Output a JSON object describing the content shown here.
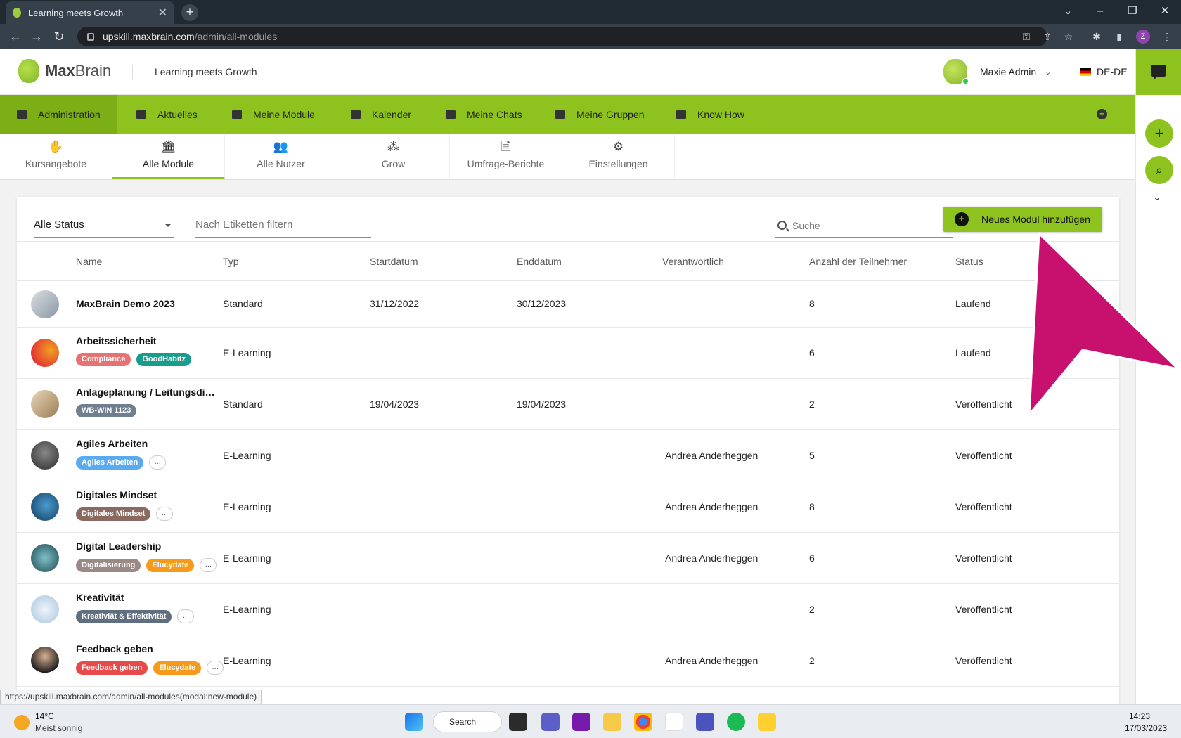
{
  "browser": {
    "tab_title": "Learning meets Growth",
    "url_host": "upskill.maxbrain.com",
    "url_path": "/admin/all-modules",
    "profile_initial": "Z",
    "status_url": "https://upskill.maxbrain.com/admin/all-modules(modal:new-module)"
  },
  "header": {
    "logo_bold": "Max",
    "logo_light": "Brain",
    "tagline": "Learning meets Growth",
    "user_name": "Maxie Admin",
    "language": "DE-DE"
  },
  "nav": {
    "items": [
      {
        "label": "Administration",
        "icon": "dashboard-icon"
      },
      {
        "label": "Aktuelles",
        "icon": "news-icon"
      },
      {
        "label": "Meine Module",
        "icon": "graduation-cap-icon"
      },
      {
        "label": "Kalender",
        "icon": "calendar-icon"
      },
      {
        "label": "Meine Chats",
        "icon": "chat-icon"
      },
      {
        "label": "Meine Gruppen",
        "icon": "group-icon"
      },
      {
        "label": "Know How",
        "icon": "book-icon"
      }
    ]
  },
  "subtabs": [
    {
      "label": "Kursangebote",
      "icon": "hand-book-icon"
    },
    {
      "label": "Alle Module",
      "icon": "institution-icon"
    },
    {
      "label": "Alle Nutzer",
      "icon": "users-icon"
    },
    {
      "label": "Grow",
      "icon": "people-group-icon"
    },
    {
      "label": "Umfrage-Berichte",
      "icon": "report-file-icon"
    },
    {
      "label": "Einstellungen",
      "icon": "gears-icon"
    }
  ],
  "filters": {
    "status_value": "Alle Status",
    "tags_placeholder": "Nach Etiketten filtern",
    "search_placeholder": "Suche",
    "add_button": "Neues Modul hinzufügen"
  },
  "table": {
    "columns": [
      "Name",
      "Typ",
      "Startdatum",
      "Enddatum",
      "Verantwortlich",
      "Anzahl der Teilnehmer",
      "Status"
    ],
    "rows": [
      {
        "name": "MaxBrain Demo 2023",
        "type": "Standard",
        "start": "31/12/2022",
        "end": "30/12/2023",
        "owner": "",
        "count": "8",
        "status": "Laufend",
        "tags": [],
        "more": false
      },
      {
        "name": "Arbeitssicherheit",
        "type": "E-Learning",
        "start": "",
        "end": "",
        "owner": "",
        "count": "6",
        "status": "Laufend",
        "tags": [
          {
            "label": "Compliance",
            "color": "#e57373"
          },
          {
            "label": "GoodHabitz",
            "color": "#1a9c8c"
          }
        ],
        "more": false
      },
      {
        "name": "Anlageplanung / Leitungsdimensionierung",
        "type": "Standard",
        "start": "19/04/2023",
        "end": "19/04/2023",
        "owner": "",
        "count": "2",
        "status": "Veröffentlicht",
        "tags": [
          {
            "label": "WB-WIN 1123",
            "color": "#6f7f8f"
          }
        ],
        "more": false
      },
      {
        "name": "Agiles Arbeiten",
        "type": "E-Learning",
        "start": "",
        "end": "",
        "owner": "Andrea Anderheggen",
        "count": "5",
        "status": "Veröffentlicht",
        "tags": [
          {
            "label": "Agiles Arbeiten",
            "color": "#5aaaf0"
          }
        ],
        "more": true
      },
      {
        "name": "Digitales Mindset",
        "type": "E-Learning",
        "start": "",
        "end": "",
        "owner": "Andrea Anderheggen",
        "count": "8",
        "status": "Veröffentlicht",
        "tags": [
          {
            "label": "Digitales Mindset",
            "color": "#8a6a60"
          }
        ],
        "more": true
      },
      {
        "name": "Digital Leadership",
        "type": "E-Learning",
        "start": "",
        "end": "",
        "owner": "Andrea Anderheggen",
        "count": "6",
        "status": "Veröffentlicht",
        "tags": [
          {
            "label": "Digitalisierung",
            "color": "#9a8a86"
          },
          {
            "label": "Elucydate",
            "color": "#f59a1a"
          }
        ],
        "more": true
      },
      {
        "name": "Kreativität",
        "type": "E-Learning",
        "start": "",
        "end": "",
        "owner": "",
        "count": "2",
        "status": "Veröffentlicht",
        "tags": [
          {
            "label": "Kreativiät & Effektivität",
            "color": "#5f6f7f"
          }
        ],
        "more": true
      },
      {
        "name": "Feedback geben",
        "type": "E-Learning",
        "start": "",
        "end": "",
        "owner": "Andrea Anderheggen",
        "count": "2",
        "status": "Veröffentlicht",
        "tags": [
          {
            "label": "Feedback geben",
            "color": "#e84a4a"
          },
          {
            "label": "Elucydate",
            "color": "#f59a1a"
          }
        ],
        "more": true
      }
    ],
    "more_label": "..."
  },
  "taskbar": {
    "temperature": "14°C",
    "weather": "Meist sonnig",
    "search_label": "Search",
    "time": "14:23",
    "date": "17/03/2023"
  },
  "colors": {
    "brand_green": "#8dc21f",
    "cursor_magenta": "#c8106e"
  }
}
